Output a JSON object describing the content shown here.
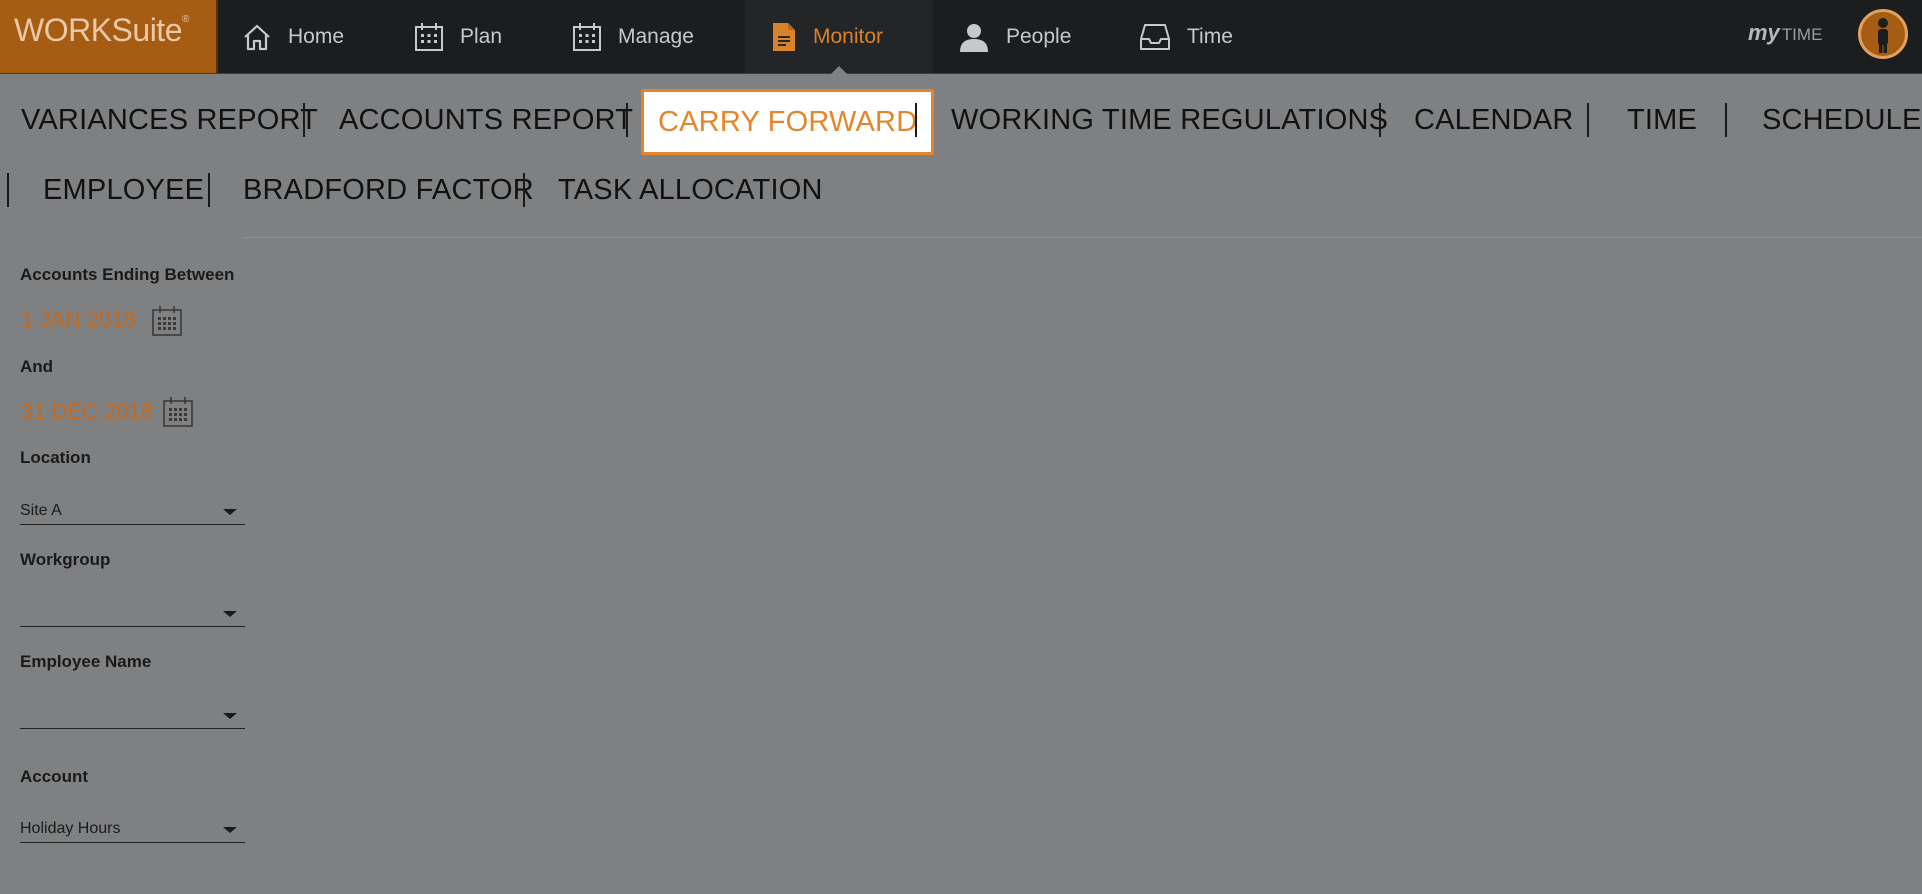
{
  "logo": {
    "text": "WORKSuite",
    "mark": "®"
  },
  "nav": [
    {
      "label": "Home",
      "icon": "home-icon"
    },
    {
      "label": "Plan",
      "icon": "calendar-icon"
    },
    {
      "label": "Manage",
      "icon": "calendar-icon"
    },
    {
      "label": "Monitor",
      "icon": "document-icon",
      "active": true
    },
    {
      "label": "People",
      "icon": "person-icon"
    },
    {
      "label": "Time",
      "icon": "inbox-icon"
    }
  ],
  "mytime": {
    "my": "my",
    "time": "TIME"
  },
  "report_tabs": [
    "VARIANCES REPORT",
    "ACCOUNTS REPORT",
    "CARRY FORWARD",
    "WORKING TIME REGULATIONS",
    "CALENDAR",
    "TIME",
    "SCHEDULE",
    "EMPLOYEE",
    "BRADFORD FACTOR",
    "TASK ALLOCATION"
  ],
  "active_tab": "CARRY FORWARD",
  "filters": {
    "accounts_ending_label": "Accounts Ending Between",
    "start_date": "1 JAN 2018",
    "and_label": "And",
    "end_date": "31 DEC 2018",
    "location_label": "Location",
    "location_value": "Site A",
    "workgroup_label": "Workgroup",
    "workgroup_value": "",
    "employee_label": "Employee Name",
    "employee_value": "",
    "account_label": "Account",
    "account_value": "Holiday Hours"
  },
  "colors": {
    "accent": "#e5852a",
    "logo_bg": "#a65c13",
    "topbar_bg": "#1b1d1f",
    "page_bg": "#7f8082"
  }
}
